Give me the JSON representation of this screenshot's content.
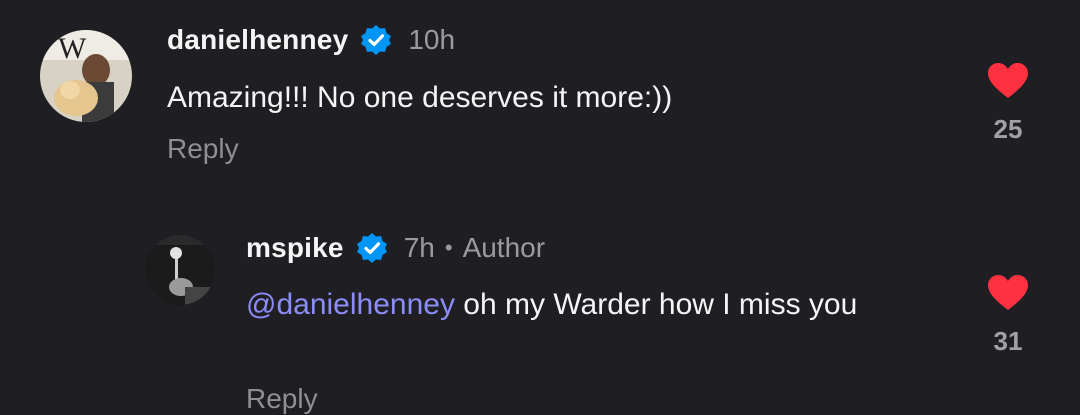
{
  "comments": [
    {
      "username": "danielhenney",
      "verified": true,
      "time": "10h",
      "text": "Amazing!!! No one deserves it more:))",
      "reply_label": "Reply",
      "likes": "25",
      "liked": true
    },
    {
      "username": "mspike",
      "verified": true,
      "time": "7h",
      "author_label": "Author",
      "mention": "@danielhenney",
      "text": " oh my Warder how I miss you",
      "reply_label": "Reply",
      "likes": "31",
      "liked": true
    }
  ],
  "colors": {
    "background": "#1f1f23",
    "heart": "#ff3040",
    "verified": "#0095f6",
    "mention": "#8b8cf6"
  },
  "icons": [
    "verified-badge-icon",
    "heart-icon"
  ]
}
